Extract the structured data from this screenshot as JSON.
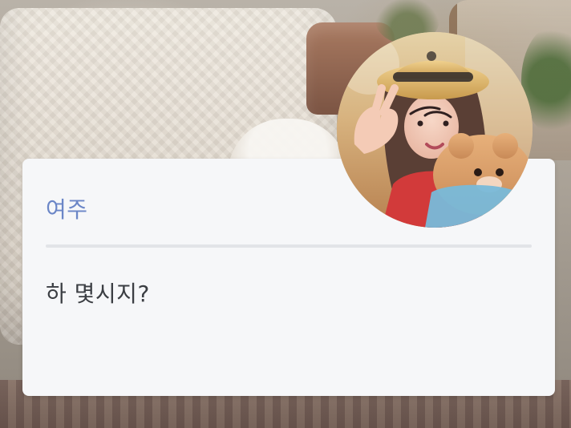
{
  "dialog": {
    "speaker_name": "여주",
    "message": "하 몇시지?"
  },
  "colors": {
    "speaker": "#6b86c7",
    "message": "#3b3e43",
    "card_bg": "#f6f7f9",
    "divider": "#e2e4e8"
  },
  "icons": {
    "avatar": "profile-photo"
  }
}
